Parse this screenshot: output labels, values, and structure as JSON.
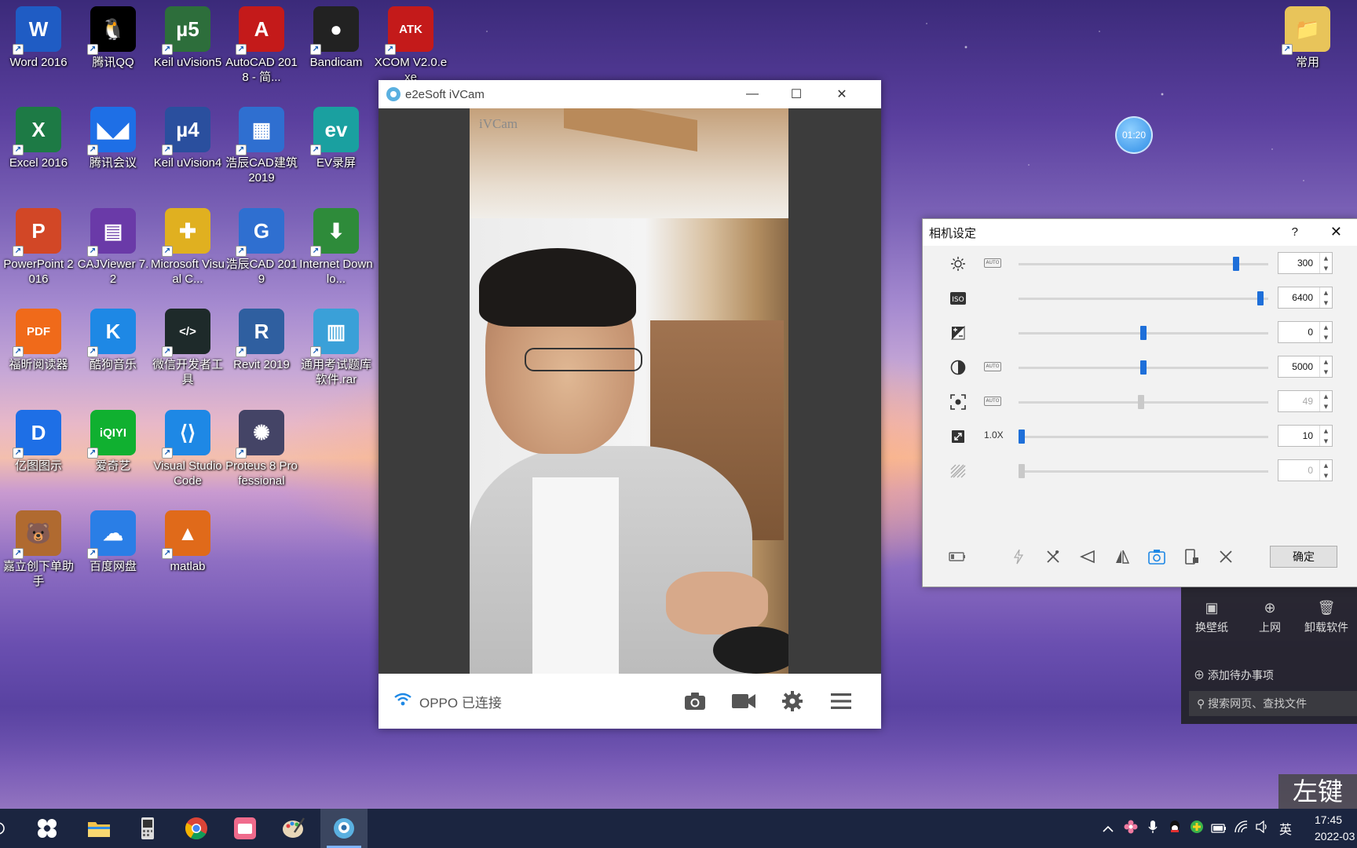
{
  "desktop_icons": [
    {
      "label": "Word 2016",
      "glyph": "W",
      "color": "#1f5cc4"
    },
    {
      "label": "腾讯QQ",
      "glyph": "🐧",
      "color": "#000000"
    },
    {
      "label": "Keil uVision5",
      "glyph": "µ5",
      "color": "#2d6e3b"
    },
    {
      "label": "AutoCAD 2018 - 简...",
      "glyph": "A",
      "color": "#c41a1a"
    },
    {
      "label": "Bandicam",
      "glyph": "●",
      "color": "#222222"
    },
    {
      "label": "XCOM V2.0.exe",
      "glyph": "ATK",
      "color": "#c41a1a"
    },
    {
      "label": "Excel 2016",
      "glyph": "X",
      "color": "#1d7a45"
    },
    {
      "label": "腾讯会议",
      "glyph": "◣◢",
      "color": "#1e6fe6"
    },
    {
      "label": "Keil uVision4",
      "glyph": "µ4",
      "color": "#2a4f9e"
    },
    {
      "label": "浩辰CAD建筑 2019",
      "glyph": "▦",
      "color": "#2f6fd0"
    },
    {
      "label": "EV录屏",
      "glyph": "ev",
      "color": "#1aa0a0"
    },
    {
      "label": "PowerPoint 2016",
      "glyph": "P",
      "color": "#d24726"
    },
    {
      "label": "CAJViewer 7.2",
      "glyph": "▤",
      "color": "#6a3aa8"
    },
    {
      "label": "Microsoft Visual C...",
      "glyph": "✚",
      "color": "#e0b020"
    },
    {
      "label": "浩辰CAD 2019",
      "glyph": "G",
      "color": "#2f6fd0"
    },
    {
      "label": "Internet Downlo...",
      "glyph": "⬇",
      "color": "#2e8b3a"
    },
    {
      "label": "福昕阅读器",
      "glyph": "PDF",
      "color": "#f06a1a"
    },
    {
      "label": "酷狗音乐",
      "glyph": "K",
      "color": "#1e88e5"
    },
    {
      "label": "微信开发者工具",
      "glyph": "</>",
      "color": "#1e2a2a"
    },
    {
      "label": "Revit 2019",
      "glyph": "R",
      "color": "#2f5fa0"
    },
    {
      "label": "通用考试题库软件.rar",
      "glyph": "▥",
      "color": "#3aa0d8"
    },
    {
      "label": "亿图图示",
      "glyph": "D",
      "color": "#1e6fe6"
    },
    {
      "label": "爱奇艺",
      "glyph": "iQIYI",
      "color": "#10b030"
    },
    {
      "label": "Visual Studio Code",
      "glyph": "⟨⟩",
      "color": "#1e88e5"
    },
    {
      "label": "Proteus 8 Professional",
      "glyph": "✺",
      "color": "#444466"
    },
    {
      "label": "嘉立创下单助手",
      "glyph": "🐻",
      "color": "#b06a30"
    },
    {
      "label": "百度网盘",
      "glyph": "☁",
      "color": "#2a7ee6"
    },
    {
      "label": "matlab",
      "glyph": "▲",
      "color": "#e06a1a"
    },
    {
      "label": "常用",
      "glyph": "📁",
      "color": "#e8c45a"
    }
  ],
  "clock_bubble": "01:20",
  "ivcam": {
    "title": "e2eSoft iVCam",
    "watermark": "iVCam",
    "status": "OPPO 已连接",
    "buttons": {
      "minimize": "—",
      "maximize": "☐",
      "close": "✕"
    }
  },
  "settings": {
    "title": "相机设定",
    "help": "?",
    "close": "✕",
    "auto_label": "AUTO",
    "zoom_label": "1.0X",
    "rows": [
      {
        "name": "brightness",
        "value": "300",
        "level": 0.88,
        "has_auto": true,
        "enabled": true
      },
      {
        "name": "iso",
        "value": "6400",
        "level": 0.98,
        "has_auto": false,
        "enabled": true
      },
      {
        "name": "exposure",
        "value": "0",
        "level": 0.5,
        "has_auto": false,
        "enabled": true
      },
      {
        "name": "white-balance",
        "value": "5000",
        "level": 0.5,
        "has_auto": true,
        "enabled": true
      },
      {
        "name": "focus",
        "value": "49",
        "level": 0.49,
        "has_auto": true,
        "enabled": false
      },
      {
        "name": "zoom",
        "value": "10",
        "level": 0.0,
        "has_auto": false,
        "enabled": true
      },
      {
        "name": "anti-banding",
        "value": "0",
        "level": 0.0,
        "has_auto": false,
        "enabled": false
      }
    ],
    "ok_label": "确定"
  },
  "side_panel": {
    "actions": [
      "换壁纸",
      "上网",
      "卸载软件"
    ],
    "add_todo": "添加待办事项",
    "search": "搜索网页、查找文件"
  },
  "watermark_text": "左键",
  "taskbar": {
    "ime": "英",
    "time": "17:45",
    "date": "2022-03"
  }
}
